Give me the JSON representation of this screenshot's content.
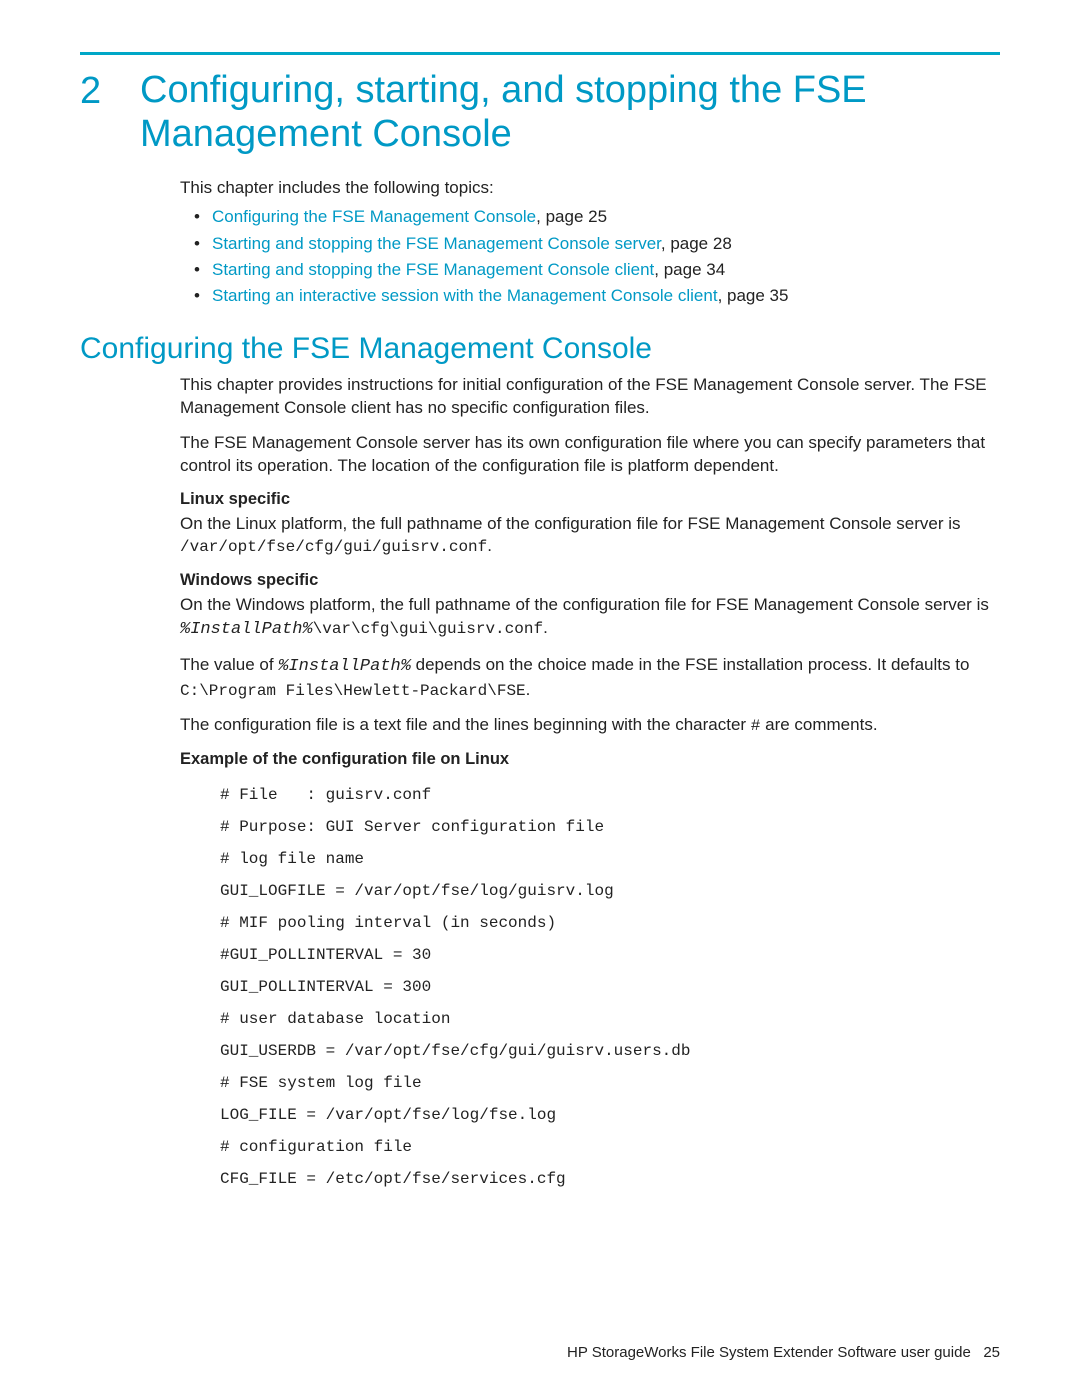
{
  "chapter": {
    "number": "2",
    "title": "Configuring, starting, and stopping the FSE Management Console"
  },
  "intro": "This chapter includes the following topics:",
  "toc": [
    {
      "link": "Configuring the FSE Management Console",
      "suffix": ", page 25"
    },
    {
      "link": "Starting and stopping the FSE Management Console server",
      "suffix": ", page 28"
    },
    {
      "link": "Starting and stopping the FSE Management Console client",
      "suffix": ", page 34"
    },
    {
      "link": "Starting an interactive session with the Management Console client",
      "suffix": ", page 35"
    }
  ],
  "section1": {
    "heading": "Configuring the FSE Management Console",
    "p1": "This chapter provides instructions for initial configuration of the FSE Management Console server. The FSE Management Console client has no specific configuration files.",
    "p2": "The FSE Management Console server has its own configuration file where you can specify parameters that control its operation. The location of the configuration file is platform dependent.",
    "linux_h": "Linux specific",
    "linux_p_pre": "On the Linux platform, the full pathname of the configuration file for FSE Management Console server is ",
    "linux_code": "/var/opt/fse/cfg/gui/guisrv.conf",
    "linux_p_post": ".",
    "win_h": "Windows specific",
    "win_p1_pre": "On the Windows platform, the full pathname of the configuration file for FSE Management Console server is ",
    "win_p1_code1": "%InstallPath%",
    "win_p1_code2": "\\var\\cfg\\gui\\guisrv.conf",
    "win_p1_post": ".",
    "win_p2_a": "The value of ",
    "win_p2_code": "%InstallPath%",
    "win_p2_b": " depends on the choice made in the FSE installation process. It defaults to ",
    "win_p2_code2": "C:\\Program Files\\Hewlett-Packard\\FSE",
    "win_p2_c": ".",
    "p3_a": "The configuration file is a text file and the lines beginning with the character ",
    "p3_code": "#",
    "p3_b": " are comments.",
    "example_h": "Example of the configuration file on Linux",
    "code": [
      "# File   : guisrv.conf",
      "# Purpose: GUI Server configuration file",
      "",
      "# log file name",
      "GUI_LOGFILE = /var/opt/fse/log/guisrv.log",
      "",
      "# MIF pooling interval (in seconds)",
      "#GUI_POLLINTERVAL = 30",
      "GUI_POLLINTERVAL = 300",
      "",
      "# user database location",
      "GUI_USERDB = /var/opt/fse/cfg/gui/guisrv.users.db",
      "",
      "# FSE system log file",
      "LOG_FILE = /var/opt/fse/log/fse.log",
      "",
      "# configuration file",
      "CFG_FILE = /etc/opt/fse/services.cfg"
    ]
  },
  "footer": {
    "text": "HP StorageWorks File System Extender Software user guide",
    "page": "25"
  }
}
